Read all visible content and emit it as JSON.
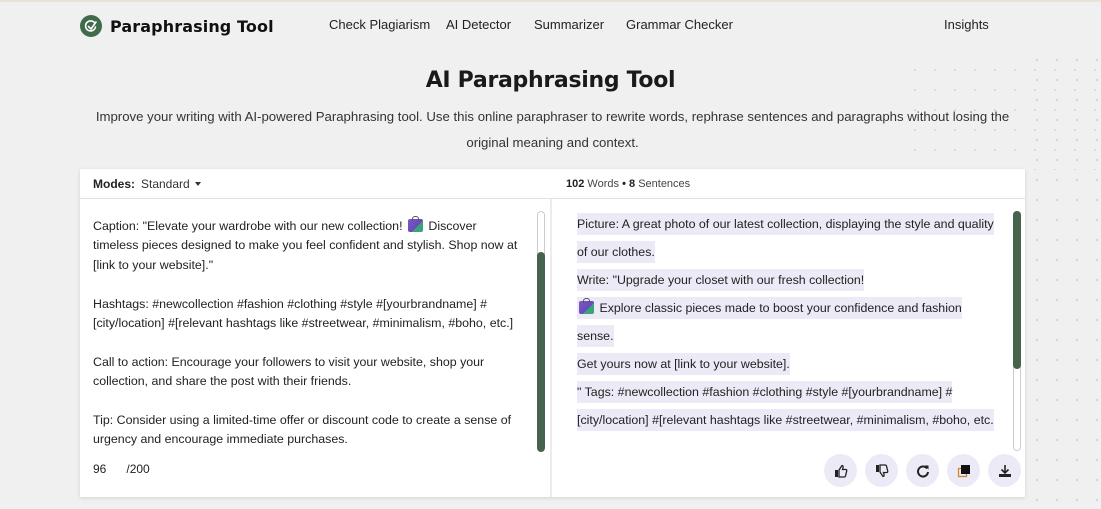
{
  "header": {
    "logo_text": "Paraphrasing Tool",
    "nav": [
      "Check Plagiarism",
      "AI Detector",
      "Summarizer",
      "Grammar Checker",
      "Insights"
    ]
  },
  "hero": {
    "title": "AI Paraphrasing Tool",
    "subtitle": "Improve your writing with AI-powered Paraphrasing tool. Use this online paraphraser to rewrite words, rephrase sentences and paragraphs without losing the original meaning and context."
  },
  "toolbar": {
    "modes_label": "Modes:",
    "mode_selected": "Standard",
    "word_count": "102",
    "words_label": "Words",
    "bullet": "•",
    "sentence_count": "8",
    "sentences_label": "Sentences"
  },
  "input": {
    "paragraphs": [
      {
        "before": "Caption: \"Elevate your wardrobe with our new collection! ",
        "emoji": "shopping-bags",
        "after": " Discover timeless pieces designed to make you feel confident and stylish. Shop now at [link to your website].\""
      },
      {
        "text": "Hashtags: #newcollection #fashion #clothing #style #[yourbrandname] #[city/location] #[relevant hashtags like #streetwear, #minimalism, #boho, etc.]"
      },
      {
        "text": "Call to action: Encourage your followers to visit your website, shop your collection, and share the post with their friends."
      },
      {
        "text": "Tip: Consider using a limited-time offer or discount code to create a sense of urgency and encourage immediate purchases."
      }
    ],
    "word_counter": "96",
    "word_limit": "/200"
  },
  "output": {
    "sentences": [
      "Picture: A great photo of our latest collection, displaying the style and quality of our clothes.",
      "Write: \"Upgrade your closet with our fresh collection!",
      " Explore classic pieces made to boost your confidence and fashion sense.",
      "Get yours now at [link to your website].",
      "\" Tags: #newcollection #fashion #clothing #style #[yourbrandname] #[city/location] #[relevant hashtags like #streetwear, #minimalism, #boho, etc."
    ]
  },
  "actions": [
    {
      "name": "thumbs-up",
      "label": "Like"
    },
    {
      "name": "thumbs-down",
      "label": "Dislike"
    },
    {
      "name": "refresh",
      "label": "Rephrase"
    },
    {
      "name": "copy",
      "label": "Copy"
    },
    {
      "name": "download",
      "label": "Download"
    }
  ],
  "colors": {
    "brand": "#3f6b4b",
    "scroll_thumb": "#46634e",
    "highlight": "#eceaf6",
    "background": "#f0f0f0"
  }
}
